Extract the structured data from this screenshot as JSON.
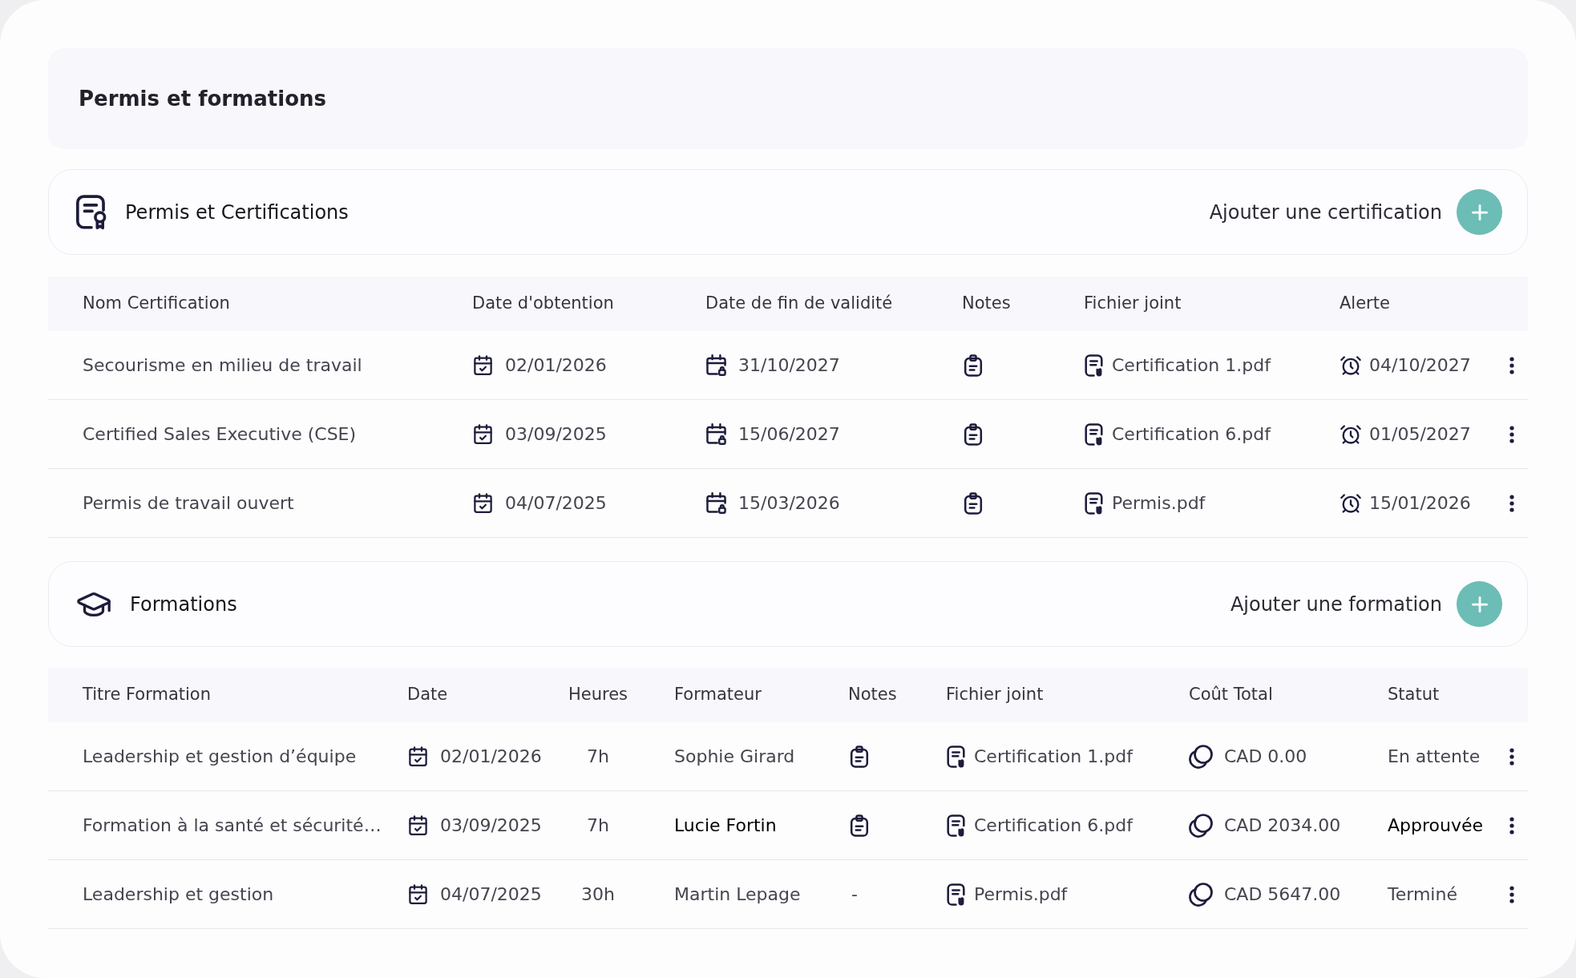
{
  "page": {
    "title": "Permis et formations"
  },
  "certifications": {
    "title": "Permis et Certifications",
    "add_label": "Ajouter une certification",
    "columns": [
      "Nom Certification",
      "Date d'obtention",
      "Date de fin de validité",
      "Notes",
      "Fichier joint",
      "Alerte"
    ],
    "rows": [
      {
        "name": "Secourisme en milieu de travail",
        "obtained": "02/01/2026",
        "expires": "31/10/2027",
        "notes": {
          "kind": "icon"
        },
        "file": "Certification 1.pdf",
        "alert": "04/10/2027"
      },
      {
        "name": "Certified Sales Executive (CSE)",
        "obtained": "03/09/2025",
        "expires": "15/06/2027",
        "notes": {
          "kind": "icon"
        },
        "file": "Certification 6.pdf",
        "alert": "01/05/2027"
      },
      {
        "name": "Permis de travail ouvert",
        "obtained": "04/07/2025",
        "expires": "15/03/2026",
        "notes": {
          "kind": "icon"
        },
        "file": "Permis.pdf",
        "alert": "15/01/2026"
      }
    ]
  },
  "formations": {
    "title": "Formations",
    "add_label": "Ajouter une formation",
    "columns": [
      "Titre Formation",
      "Date",
      "Heures",
      "Formateur",
      "Notes",
      "Fichier joint",
      "Coût Total",
      "Statut"
    ],
    "rows": [
      {
        "title": "Leadership et gestion d’équipe",
        "date": "02/01/2026",
        "hours": "7h",
        "trainer": {
          "text": "Sophie Girard",
          "emphasized": false
        },
        "notes": {
          "kind": "icon"
        },
        "file": "Certification 1.pdf",
        "cost": "CAD 0.00",
        "status": {
          "text": "En attente",
          "emphasized": false
        }
      },
      {
        "title": "Formation à la santé et sécurité…",
        "date": "03/09/2025",
        "hours": "7h",
        "trainer": {
          "text": "Lucie Fortin",
          "emphasized": true
        },
        "notes": {
          "kind": "icon"
        },
        "file": "Certification 6.pdf",
        "cost": "CAD 2034.00",
        "status": {
          "text": "Approuvée",
          "emphasized": true
        }
      },
      {
        "title": "Leadership et gestion",
        "date": "04/07/2025",
        "hours": "30h",
        "trainer": {
          "text": "Martin Lepage",
          "emphasized": false
        },
        "notes": {
          "kind": "text",
          "text": "-"
        },
        "file": "Permis.pdf",
        "cost": "CAD 5647.00",
        "status": {
          "text": "Terminé",
          "emphasized": false
        }
      }
    ]
  }
}
